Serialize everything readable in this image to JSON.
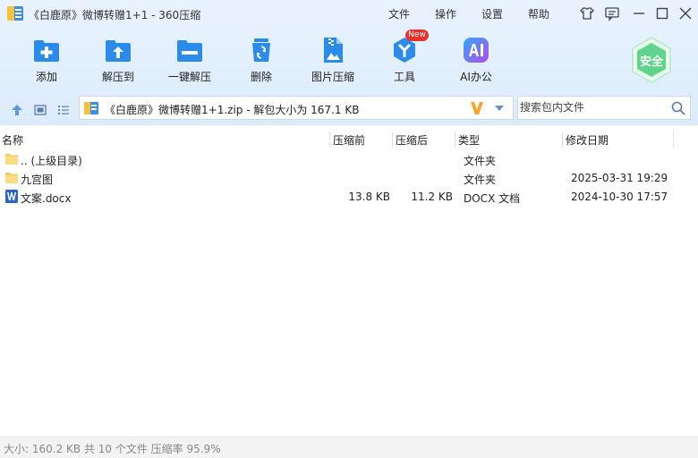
{
  "titlebar": {
    "title": "《白鹿原》微博转赠1+1 - 360压缩",
    "menu": [
      "文件",
      "操作",
      "设置",
      "帮助"
    ]
  },
  "toolbar": {
    "tools": [
      {
        "label": "添加",
        "icon": "add-icon"
      },
      {
        "label": "解压到",
        "icon": "extract-to-icon"
      },
      {
        "label": "一键解压",
        "icon": "one-click-extract-icon"
      },
      {
        "label": "删除",
        "icon": "delete-icon"
      },
      {
        "label": "图片压缩",
        "icon": "image-compress-icon"
      },
      {
        "label": "工具",
        "icon": "tools-icon"
      },
      {
        "label": "AI办公",
        "icon": "ai-office-icon"
      }
    ],
    "new_badge": "New",
    "safe_label": "安全"
  },
  "nav": {
    "path": "《白鹿原》微博转赠1+1.zip - 解包大小为 167.1 KB",
    "search_placeholder": "搜索包内文件"
  },
  "columns": [
    "名称",
    "压缩前",
    "压缩后",
    "类型",
    "修改日期"
  ],
  "files": [
    {
      "name": ".. (上级目录)",
      "before": "",
      "after": "",
      "type": "文件夹",
      "date": "",
      "icon": "folder-icon"
    },
    {
      "name": "九宫图",
      "before": "",
      "after": "",
      "type": "文件夹",
      "date": "2025-03-31 19:29",
      "icon": "folder-icon"
    },
    {
      "name": "文案.docx",
      "before": "13.8 KB",
      "after": "11.2 KB",
      "type": "DOCX 文档",
      "date": "2024-10-30 17:57",
      "icon": "word-doc-icon"
    }
  ],
  "status": "大小: 160.2 KB 共 10 个文件 压缩率 95.9%",
  "colors": {
    "accent": "#2a8bea",
    "safe_green": "#5fd48a",
    "toolbar_bg": "#e3effc"
  }
}
